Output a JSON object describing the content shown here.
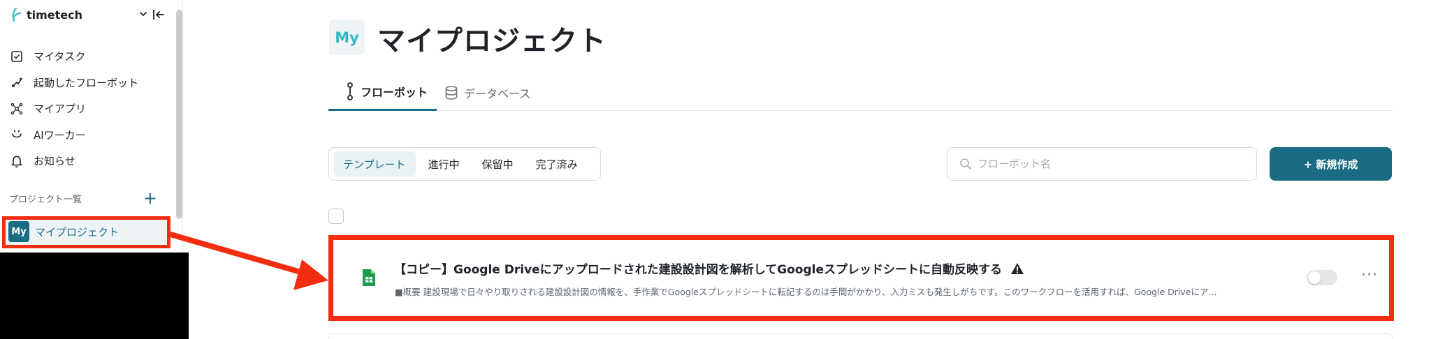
{
  "brand": {
    "name": "timetech"
  },
  "sidebar": {
    "items": [
      {
        "label": "マイタスク",
        "icon": "checkbox-icon"
      },
      {
        "label": "起動したフローボット",
        "icon": "flow-trigger-icon"
      },
      {
        "label": "マイアプリ",
        "icon": "apps-icon"
      },
      {
        "label": "AIワーカー",
        "icon": "ai-worker-icon"
      },
      {
        "label": "お知らせ",
        "icon": "bell-icon"
      }
    ],
    "projects_title": "プロジェクト一覧",
    "add_symbol": "+",
    "project": {
      "badge": "My",
      "label": "マイプロジェクト"
    }
  },
  "header": {
    "badge": "My",
    "title": "マイプロジェクト",
    "tabs": [
      {
        "label": "フローボット",
        "icon": "flowbot-icon",
        "active": true
      },
      {
        "label": "データベース",
        "icon": "database-icon",
        "active": false
      }
    ]
  },
  "filters": {
    "segments": [
      "テンプレート",
      "進行中",
      "保留中",
      "完了済み"
    ],
    "active": "テンプレート"
  },
  "search": {
    "placeholder": "フローボット名",
    "value": ""
  },
  "new_button": {
    "label": "+ 新規作成"
  },
  "flow": {
    "icon": "google-sheets-icon",
    "title": "【コピー】Google Driveにアップロードされた建設設計図を解析してGoogleスプレッドシートに自動反映する",
    "warning_icon": "warning-icon",
    "description": "■概要 建設現場で日々やり取りされる建設設計図の情報を、手作業でGoogleスプレッドシートに転記するのは手間がかかり、入力ミスも発生しがちです。このワークフローを活用すれば、Google Driveにア...",
    "enabled": false,
    "more_symbol": "···"
  },
  "colors": {
    "accent": "#1a6b84",
    "highlight": "#f22d10",
    "badge_text": "#35b7c4",
    "sheets_green": "#1e9b4e"
  }
}
